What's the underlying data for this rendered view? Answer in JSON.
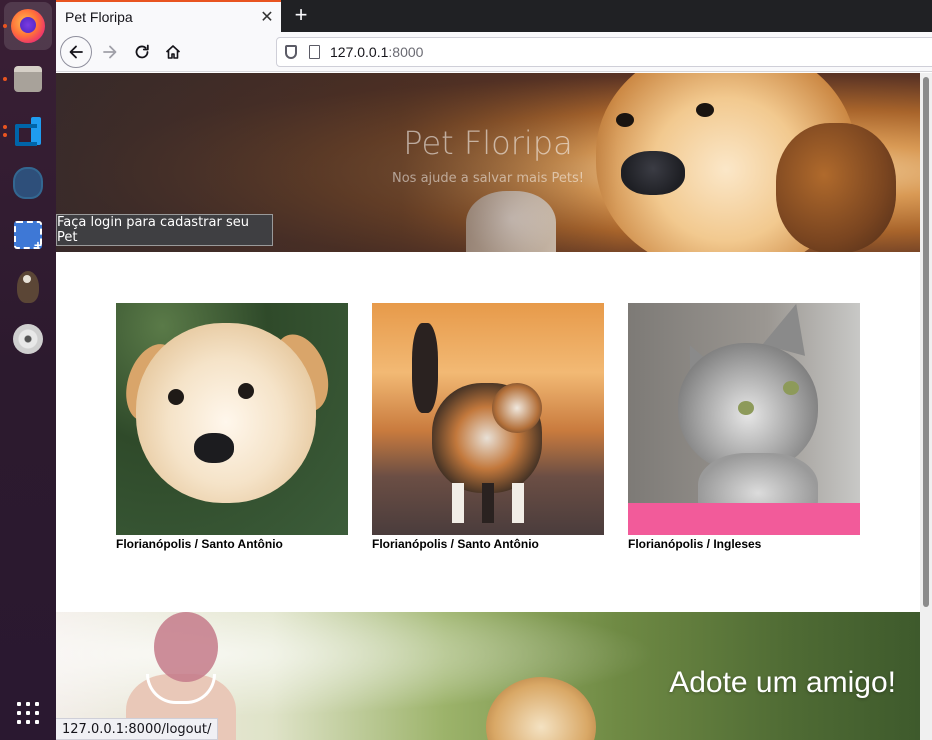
{
  "dock": {
    "items": [
      {
        "name": "firefox"
      },
      {
        "name": "files"
      },
      {
        "name": "vscode"
      },
      {
        "name": "pgadmin"
      },
      {
        "name": "screenshot"
      },
      {
        "name": "gimp"
      },
      {
        "name": "disc"
      }
    ]
  },
  "browser": {
    "tab_title": "Pet Floripa",
    "tab_close": "✕",
    "new_tab": "+",
    "url_host": "127.0.0.1",
    "url_port": ":8000",
    "status_url": "127.0.0.1:8000/logout/"
  },
  "hero": {
    "title": "Pet Floripa",
    "subtitle": "Nos ajude a salvar mais Pets!",
    "login_button": "Faça login para cadastrar seu Pet"
  },
  "pets": [
    {
      "caption": "Florianópolis / Santo Antônio",
      "kind": "dog"
    },
    {
      "caption": "Florianópolis / Santo Antônio",
      "kind": "cat"
    },
    {
      "caption": "Florianópolis / Ingleses",
      "kind": "cat"
    }
  ],
  "adopt": {
    "title": "Adote um amigo!"
  },
  "colors": {
    "ubuntu_accent": "#e95420",
    "login_button_bg": "#3f3f42",
    "tab_bar": "#202124"
  }
}
